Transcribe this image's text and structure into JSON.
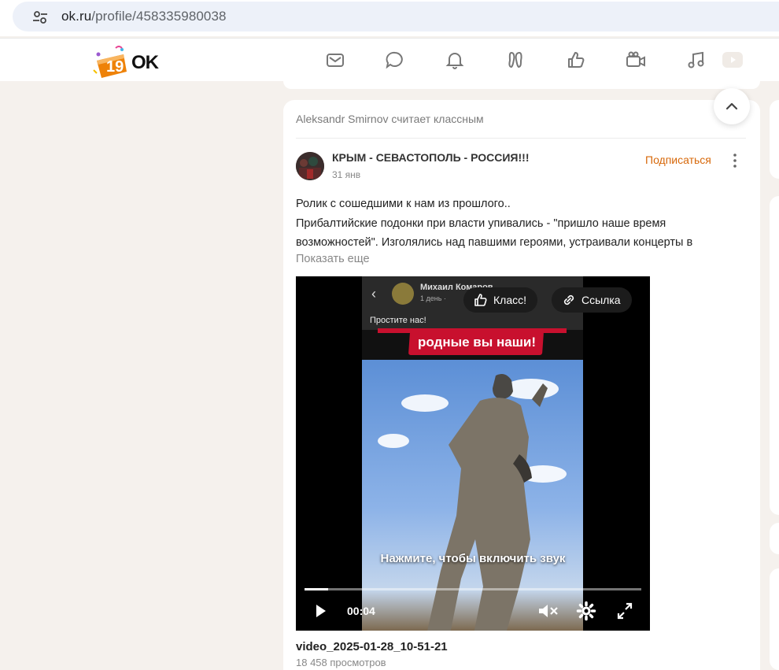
{
  "browser": {
    "url_host": "ok.ru",
    "url_path": "/profile/458335980038"
  },
  "header": {
    "logo_text": "OK",
    "nav": [
      {
        "icon": "mail-icon"
      },
      {
        "icon": "chat-icon"
      },
      {
        "icon": "bell-icon"
      },
      {
        "icon": "guests-icon"
      },
      {
        "icon": "like-icon"
      },
      {
        "icon": "video-camera-icon"
      },
      {
        "icon": "music-icon"
      },
      {
        "icon": "play-icon"
      }
    ]
  },
  "post": {
    "activity": "Aleksandr Smirnov считает классным",
    "group_name": "КРЫМ - СЕВАСТОПОЛЬ - РОССИЯ!!!",
    "date": "31 янв",
    "subscribe_label": "Подписаться",
    "text_lines": [
      "Ролик с сошедшими к нам из прошлого..",
      "Прибалтийские подонки при власти упивались - \"пришло наше время",
      "возможностей\". Изголялись над павшими героями, устраивали концерты в"
    ],
    "show_more": "Показать еще",
    "video": {
      "class_label": "Класс!",
      "link_label": "Ссылка",
      "inner_author": "Михаил Комаров",
      "inner_meta": "1 день ·",
      "inner_message": "Простите нас!",
      "banner_text": "родные вы наши!",
      "sound_hint": "Нажмите, чтобы включить звук",
      "time": "00:04",
      "progress": 0.07
    },
    "video_title": "video_2025-01-28_10-51-21",
    "video_views": "18 458 просмотров"
  },
  "colors": {
    "accent": "#ee8208",
    "subscribe": "#d7680a",
    "page_bg": "#f5f1ed"
  }
}
